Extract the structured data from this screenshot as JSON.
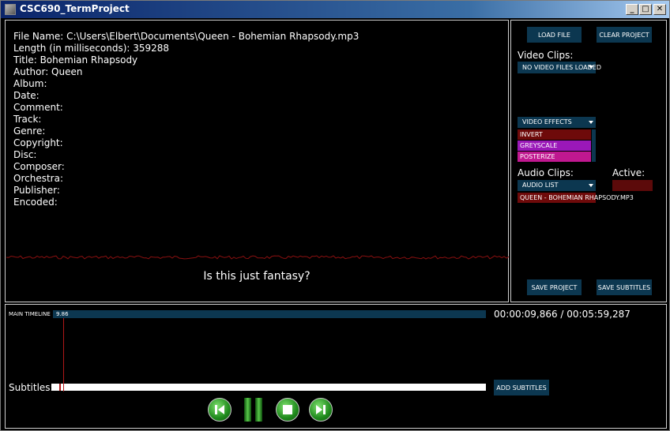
{
  "window": {
    "title": "CSC690_TermProject",
    "minimize": "_",
    "maximize": "□",
    "close": "✕"
  },
  "metadata": {
    "lines": [
      "File Name: C:\\Users\\Elbert\\Documents\\Queen - Bohemian Rhapsody.mp3",
      "Length (in milliseconds): 359288",
      "Title: Bohemian Rhapsody",
      "Author: Queen",
      "Album:",
      "Date:",
      "Comment:",
      "Track:",
      "Genre:",
      "Copyright:",
      "Disc:",
      "Composer:",
      "Orchestra:",
      "Publisher:",
      "Encoded:"
    ],
    "current_subtitle": "Is this just fantasy?"
  },
  "controls": {
    "load_file": "LOAD FILE",
    "clear_project": "CLEAR PROJECT",
    "video_clips_label": "Video Clips:",
    "video_clips_dropdown": "NO VIDEO FILES LOADED",
    "video_effects_dropdown": "VIDEO EFFECTS",
    "video_effects": [
      {
        "label": "INVERT",
        "color": "#6e0a0a"
      },
      {
        "label": "GREYSCALE",
        "color": "#9a18b8"
      },
      {
        "label": "POSTERIZE",
        "color": "#c01890"
      }
    ],
    "audio_clips_label": "Audio Clips:",
    "active_label": "Active:",
    "audio_list_dropdown": "AUDIO LIST",
    "audio_items": [
      "QUEEN - BOHEMIAN RHAPSODY.MP3"
    ],
    "save_project": "SAVE PROJECT",
    "save_subtitles": "SAVE SUBTITLES"
  },
  "timeline": {
    "label": "MAIN TIMELINE",
    "value": "9.86",
    "time_readout": "00:00:09,866 / 00:05:59,287",
    "subtitles_label": "Subtitles:",
    "add_subtitles": "ADD SUBTITLES"
  },
  "colors": {
    "panel_button": "#0c3750",
    "active_indicator": "#5c0a0a",
    "waveform": "#8a1010",
    "playhead": "#b01818"
  },
  "playback_icons": [
    "rewind-icon",
    "pause-icon",
    "stop-icon",
    "forward-icon"
  ]
}
